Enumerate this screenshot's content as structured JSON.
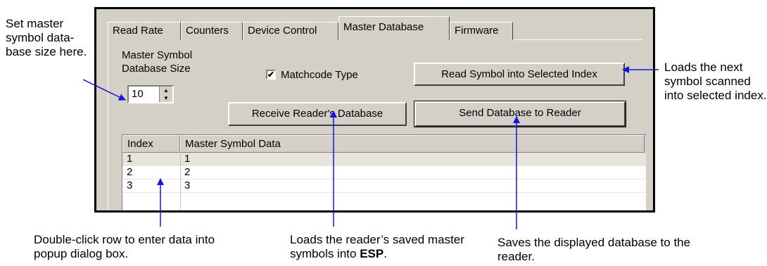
{
  "annotations": {
    "left": "Set master symbol data-base size here.",
    "right": "Loads the next symbol scanned into selected index.",
    "bottom_left": "Double-click row to enter data into popup dialog box.",
    "bottom_mid_prefix": "Loads the reader’s saved master symbols into ",
    "bottom_mid_bold": "ESP",
    "bottom_mid_suffix": ".",
    "bottom_right": "Saves the displayed database to the reader."
  },
  "tabs": [
    "Read Rate",
    "Counters",
    "Device Control",
    "Master Database",
    "Firmware"
  ],
  "active_tab": "Master Database",
  "database_size": {
    "label_line1": "Master Symbol",
    "label_line2": "Database Size",
    "value": "10"
  },
  "matchcode": {
    "label": "Matchcode Type",
    "checked": true
  },
  "buttons": {
    "read_symbol": "Read Symbol into Selected Index",
    "receive_database": "Receive Reader's Database",
    "send_database": "Send Database to Reader"
  },
  "grid": {
    "columns": [
      "Index",
      "Master Symbol Data"
    ],
    "rows": [
      [
        "1",
        "1"
      ],
      [
        "2",
        "2"
      ],
      [
        "3",
        "3"
      ]
    ]
  },
  "colors": {
    "arrow": "#1414e6",
    "dialog_bg": "#d4d0c8"
  }
}
